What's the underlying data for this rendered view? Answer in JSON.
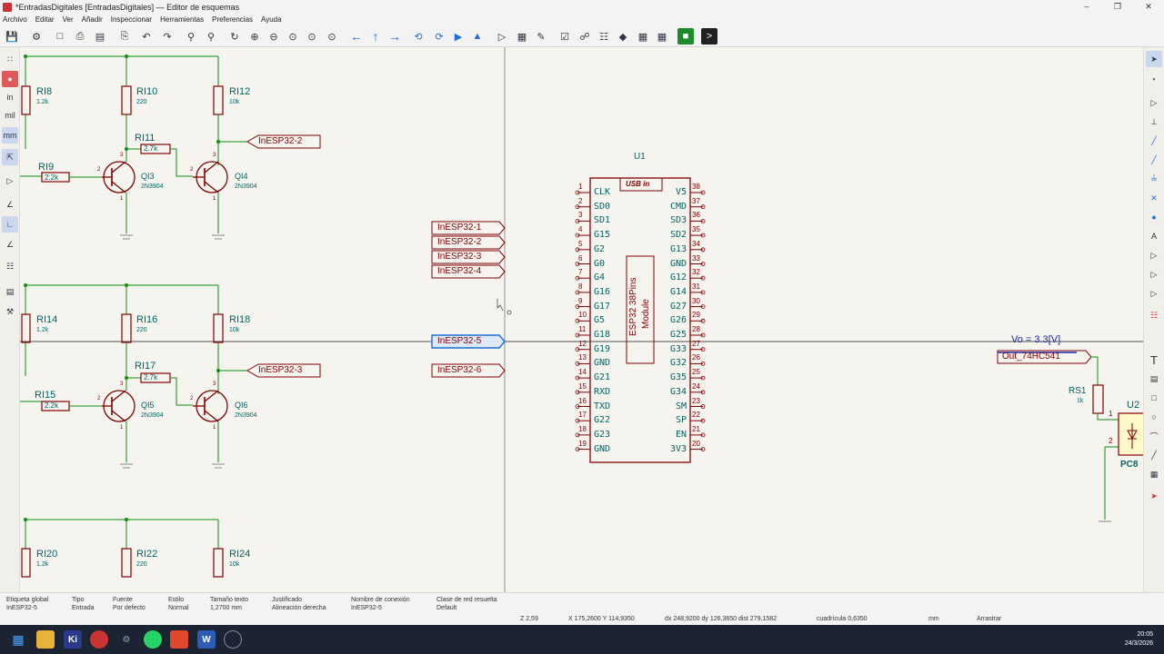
{
  "window": {
    "title": "*EntradasDigitales [EntradasDigitales] — Editor de esquemas",
    "controls": [
      "–",
      "❐",
      "✕"
    ]
  },
  "menu": [
    "Archivo",
    "Editar",
    "Ver",
    "Añadir",
    "Inspeccionar",
    "Herramientas",
    "Preferencias",
    "Ayuda"
  ],
  "toolbar_icons": [
    "save-icon",
    "schematic-setup-icon",
    "page-settings-icon",
    "print-icon",
    "plot-icon",
    "paste-icon",
    "undo-icon",
    "redo-icon",
    "find-icon",
    "find-replace-icon",
    "refresh-icon",
    "zoom-in-icon",
    "zoom-out-icon",
    "zoom-fit-icon",
    "zoom-objects-icon",
    "zoom-selection-icon",
    "navigate-back-icon",
    "navigate-up-icon",
    "navigate-forward-icon",
    "rotate-ccw-icon",
    "rotate-cw-icon",
    "mirror-v-icon",
    "mirror-h-icon",
    "symbol-editor-icon",
    "symbol-browser-icon",
    "annotate-icon",
    "erc-icon",
    "footprint-assign-icon",
    "bom-icon",
    "netlist-icon",
    "pcb-editor-icon",
    "scripting-console-icon"
  ],
  "left_tools": {
    "units": [
      "in",
      "mil",
      "mm"
    ]
  },
  "right_tools": [
    "select-icon",
    "highlight-net-icon",
    "add-symbol-icon",
    "add-power-icon",
    "add-wire-icon",
    "add-bus-icon",
    "bus-entry-icon",
    "no-connect-icon",
    "junction-icon",
    "net-label-icon",
    "global-label-icon",
    "hier-label-icon",
    "hier-sheet-icon",
    "text-icon",
    "textbox-icon",
    "rectangle-icon",
    "circle-icon",
    "arc-icon",
    "line-icon",
    "image-icon",
    "delete-icon"
  ],
  "schematic": {
    "resistors": [
      {
        "ref": "RI8",
        "value": "1.2k"
      },
      {
        "ref": "RI10",
        "value": "220"
      },
      {
        "ref": "RI12",
        "value": "10k"
      },
      {
        "ref": "RI11",
        "value": "2.7k"
      },
      {
        "ref": "RI9",
        "value": "2.2k"
      },
      {
        "ref": "RI14",
        "value": "1.2k"
      },
      {
        "ref": "RI16",
        "value": "220"
      },
      {
        "ref": "RI18",
        "value": "10k"
      },
      {
        "ref": "RI17",
        "value": "2.7k"
      },
      {
        "ref": "RI15",
        "value": "2.2k"
      },
      {
        "ref": "RI20",
        "value": "1.2k"
      },
      {
        "ref": "RI22",
        "value": "220"
      },
      {
        "ref": "RI24",
        "value": "10k"
      },
      {
        "ref": "RS1",
        "value": "1k"
      }
    ],
    "transistors": [
      {
        "ref": "QI3",
        "value": "2N3904"
      },
      {
        "ref": "QI4",
        "value": "2N3904"
      },
      {
        "ref": "QI5",
        "value": "2N3904"
      },
      {
        "ref": "QI6",
        "value": "2N3904"
      }
    ],
    "transistor_pins": [
      "1",
      "2",
      "3"
    ],
    "global_labels_left": [
      "InESP32-2",
      "InESP32-3"
    ],
    "global_labels_mid": [
      "InESP32-1",
      "InESP32-2",
      "InESP32-3",
      "InESP32-4",
      "InESP32-5",
      "InESP32-6"
    ],
    "ic": {
      "ref": "U1",
      "usb": "USB in",
      "body": "ESP32 38Pins",
      "module": "Module",
      "left_pins": [
        {
          "n": "1",
          "name": "CLK"
        },
        {
          "n": "2",
          "name": "SD0"
        },
        {
          "n": "3",
          "name": "SD1"
        },
        {
          "n": "4",
          "name": "G15"
        },
        {
          "n": "5",
          "name": "G2"
        },
        {
          "n": "6",
          "name": "G0"
        },
        {
          "n": "7",
          "name": "G4"
        },
        {
          "n": "8",
          "name": "G16"
        },
        {
          "n": "9",
          "name": "G17"
        },
        {
          "n": "10",
          "name": "G5"
        },
        {
          "n": "11",
          "name": "G18"
        },
        {
          "n": "12",
          "name": "G19"
        },
        {
          "n": "13",
          "name": "GND"
        },
        {
          "n": "14",
          "name": "G21"
        },
        {
          "n": "15",
          "name": "RXD"
        },
        {
          "n": "16",
          "name": "TXD"
        },
        {
          "n": "17",
          "name": "G22"
        },
        {
          "n": "18",
          "name": "G23"
        },
        {
          "n": "19",
          "name": "GND"
        }
      ],
      "right_pins": [
        {
          "n": "38",
          "name": "V5"
        },
        {
          "n": "37",
          "name": "CMD"
        },
        {
          "n": "36",
          "name": "SD3"
        },
        {
          "n": "35",
          "name": "SD2"
        },
        {
          "n": "34",
          "name": "G13"
        },
        {
          "n": "33",
          "name": "GND"
        },
        {
          "n": "32",
          "name": "G12"
        },
        {
          "n": "31",
          "name": "G14"
        },
        {
          "n": "30",
          "name": "G27"
        },
        {
          "n": "29",
          "name": "G26"
        },
        {
          "n": "28",
          "name": "G25"
        },
        {
          "n": "27",
          "name": "G33"
        },
        {
          "n": "26",
          "name": "G32"
        },
        {
          "n": "25",
          "name": "G35"
        },
        {
          "n": "24",
          "name": "G34"
        },
        {
          "n": "23",
          "name": "SM"
        },
        {
          "n": "22",
          "name": "SP"
        },
        {
          "n": "21",
          "name": "EN"
        },
        {
          "n": "20",
          "name": "3V3"
        }
      ]
    },
    "vo_label": "Vo = 3.3[V]",
    "out_label": "Out_74HC541",
    "u2_ref": "U2",
    "u2_pins": [
      "1",
      "2"
    ],
    "pc_label": "PC8"
  },
  "status": {
    "fields": [
      {
        "label": "Etiqueta global",
        "value": "InESP32-5"
      },
      {
        "label": "Tipo",
        "value": "Entrada"
      },
      {
        "label": "Fuente",
        "value": "Por defecto"
      },
      {
        "label": "Estilo",
        "value": "Normal"
      },
      {
        "label": "Tamaño texto",
        "value": "1,2700 mm"
      },
      {
        "label": "Justificado",
        "value": "Alineación derecha"
      },
      {
        "label": "Nombre de conexión",
        "value": "InESP32-5"
      },
      {
        "label": "Clase de red resuelta",
        "value": "Default"
      }
    ],
    "zoom": "Z 2,59",
    "coords": "X 175,2600  Y 114,9350",
    "delta": "dx 248,9200  dy 126,3650  dist 279,1582",
    "grid": "cuadrícula 0,6350",
    "units": "mm",
    "mode": "Arrastrar"
  },
  "taskbar": {
    "apps": [
      "start-icon",
      "file-explorer-icon",
      "kicad-icon",
      "chrome-icon",
      "settings-icon",
      "whatsapp-icon",
      "brave-icon",
      "word-icon",
      "app-icon"
    ],
    "time": "20:05",
    "date": "24/3/2026"
  },
  "colors": {
    "wire": "#109010",
    "component": "#840000",
    "ref_text": "#006464",
    "label": "#840000",
    "accent": "#1d4ed8"
  }
}
